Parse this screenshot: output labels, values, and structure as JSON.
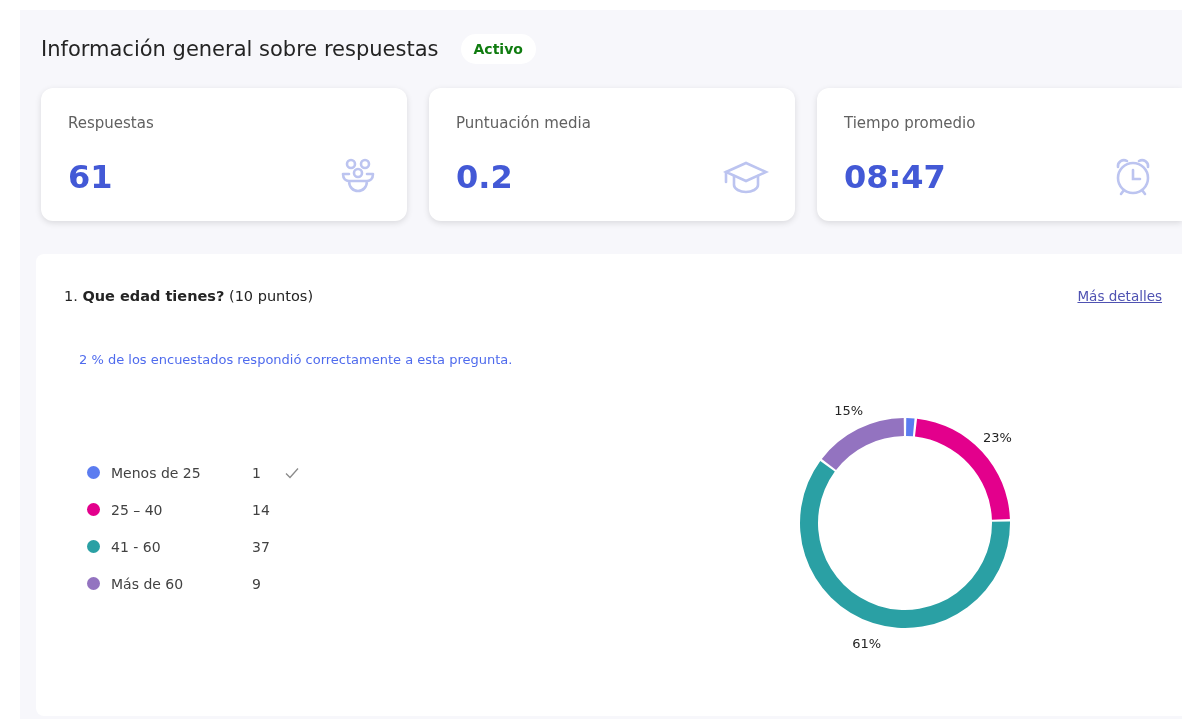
{
  "header": {
    "title": "Información general sobre respuestas",
    "status_badge": "Activo"
  },
  "stats": [
    {
      "label": "Respuestas",
      "value": "61",
      "kind": "people"
    },
    {
      "label": "Puntuación media",
      "value": "0.2",
      "kind": "grade"
    },
    {
      "label": "Tiempo promedio",
      "value": "08:47",
      "kind": "time"
    }
  ],
  "question": {
    "number": "1.",
    "title": "Que edad tienes?",
    "points": "(10 puntos)",
    "details_link": "Más detalles",
    "summary": "2 % de los encuestados respondió correctamente a esta pregunta.",
    "options": [
      {
        "count": "1",
        "checked": true,
        "color": "#5b7cf0"
      },
      {
        "count": "14",
        "checked": false,
        "color": "#e3008c"
      },
      {
        "count": "37",
        "checked": false,
        "color": "#2aa0a4"
      },
      {
        "count": "9",
        "checked": false,
        "color": "#9373c0"
      }
    ],
    "chart_data": {
      "type": "donut",
      "categories": [
        "Menos de 25",
        "25 – 40",
        "41 - 60",
        "Más de 60"
      ],
      "series": [
        {
          "values": [
            1.64,
            22.95,
            60.66,
            14.75
          ]
        }
      ],
      "value_labels": [
        null,
        "23%",
        "61%",
        "15%"
      ]
    }
  }
}
